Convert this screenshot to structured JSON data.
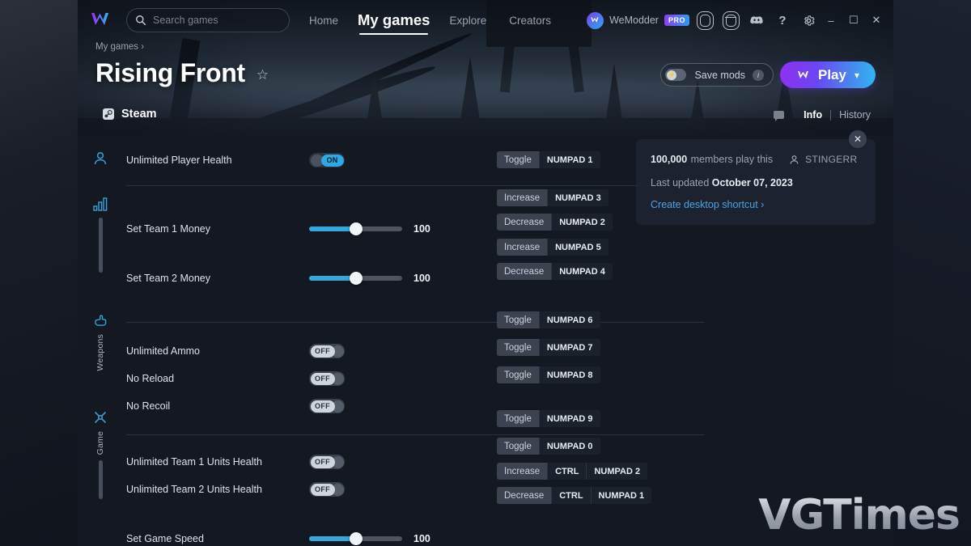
{
  "topbar": {
    "logo_icon": "wemodder-logo-icon",
    "search": {
      "placeholder": "Search games",
      "value": "",
      "icon": "search-icon"
    },
    "nav": [
      {
        "label": "Home",
        "active": false
      },
      {
        "label": "My games",
        "active": true
      },
      {
        "label": "Explore",
        "active": false
      },
      {
        "label": "Creators",
        "active": false
      }
    ],
    "account": {
      "username": "WeModder",
      "badge": "PRO"
    },
    "icons": [
      "library-icon",
      "toolbox-icon",
      "discord-icon",
      "help-icon",
      "settings-icon"
    ],
    "window_controls": {
      "minimize": "–",
      "maximize": "☐",
      "close": "✕"
    }
  },
  "hero": {
    "breadcrumb": "My games ›",
    "title": "Rising Front",
    "favorite_icon": "star-outline-icon",
    "platform": {
      "label": "Steam",
      "icon": "steam-icon"
    },
    "save_mods": {
      "label": "Save mods",
      "state": "off",
      "info_icon": "info-icon",
      "bolt_icon": "bolt-icon"
    },
    "play": {
      "label": "Play",
      "chevron": "⌄",
      "icon": "wemod-w-icon"
    }
  },
  "info_tabs": {
    "chat_icon": "chat-bubble-icon",
    "tabs": [
      {
        "label": "Info",
        "selected": true
      },
      {
        "label": "History",
        "selected": false
      }
    ]
  },
  "info_card": {
    "close_label": "✕",
    "members_count": "100,000",
    "members_text": "members play this",
    "author": "STINGERR",
    "author_icon": "person-icon",
    "updated_label": "Last updated",
    "updated_date": "October 07, 2023",
    "shortcut_link": "Create desktop shortcut ›"
  },
  "categories": [
    {
      "icon": "person-icon",
      "label": ""
    },
    {
      "icon": "bars-icon",
      "label": ""
    },
    {
      "icon": "hand-icon",
      "label": "Weapons"
    },
    {
      "icon": "crosshair-icon",
      "label": "Game"
    }
  ],
  "groups": [
    {
      "category": "player",
      "cheats": [
        {
          "name": "Unlimited Player Health",
          "control": "toggle",
          "state": "ON",
          "hotkeys": [
            {
              "action": "Toggle",
              "keys": [
                "NUMPAD 1"
              ]
            }
          ]
        }
      ]
    },
    {
      "category": "money",
      "cheats": [
        {
          "name": "Set Team 1 Money",
          "control": "slider",
          "value": "100",
          "percent": 50,
          "hotkeys": [
            {
              "action": "Increase",
              "keys": [
                "NUMPAD 3"
              ]
            },
            {
              "action": "Decrease",
              "keys": [
                "NUMPAD 2"
              ]
            }
          ]
        },
        {
          "name": "Set Team 2 Money",
          "control": "slider",
          "value": "100",
          "percent": 50,
          "hotkeys": [
            {
              "action": "Increase",
              "keys": [
                "NUMPAD 5"
              ]
            },
            {
              "action": "Decrease",
              "keys": [
                "NUMPAD 4"
              ]
            }
          ]
        }
      ]
    },
    {
      "category": "Weapons",
      "cheats": [
        {
          "name": "Unlimited Ammo",
          "control": "toggle",
          "state": "OFF",
          "hotkeys": [
            {
              "action": "Toggle",
              "keys": [
                "NUMPAD 6"
              ]
            }
          ]
        },
        {
          "name": "No Reload",
          "control": "toggle",
          "state": "OFF",
          "hotkeys": [
            {
              "action": "Toggle",
              "keys": [
                "NUMPAD 7"
              ]
            }
          ]
        },
        {
          "name": "No Recoil",
          "control": "toggle",
          "state": "OFF",
          "hotkeys": [
            {
              "action": "Toggle",
              "keys": [
                "NUMPAD 8"
              ]
            }
          ]
        }
      ]
    },
    {
      "category": "Game",
      "cheats": [
        {
          "name": "Unlimited Team 1 Units Health",
          "control": "toggle",
          "state": "OFF",
          "hotkeys": [
            {
              "action": "Toggle",
              "keys": [
                "NUMPAD 9"
              ]
            }
          ]
        },
        {
          "name": "Unlimited Team 2 Units Health",
          "control": "toggle",
          "state": "OFF",
          "hotkeys": [
            {
              "action": "Toggle",
              "keys": [
                "NUMPAD 0"
              ]
            }
          ]
        },
        {
          "name": "Set Game Speed",
          "control": "slider",
          "value": "100",
          "percent": 50,
          "hotkeys": [
            {
              "action": "Increase",
              "keys": [
                "CTRL",
                "NUMPAD 2"
              ]
            },
            {
              "action": "Decrease",
              "keys": [
                "CTRL",
                "NUMPAD 1"
              ]
            }
          ]
        }
      ]
    }
  ],
  "watermark": "VGTimes",
  "colors": {
    "accent_blue": "#2ea8e6",
    "link_blue": "#4aa3e8",
    "play_gradient_start": "#8e31f0",
    "play_gradient_end": "#2fb6ef",
    "panel_bg": "#141821"
  }
}
